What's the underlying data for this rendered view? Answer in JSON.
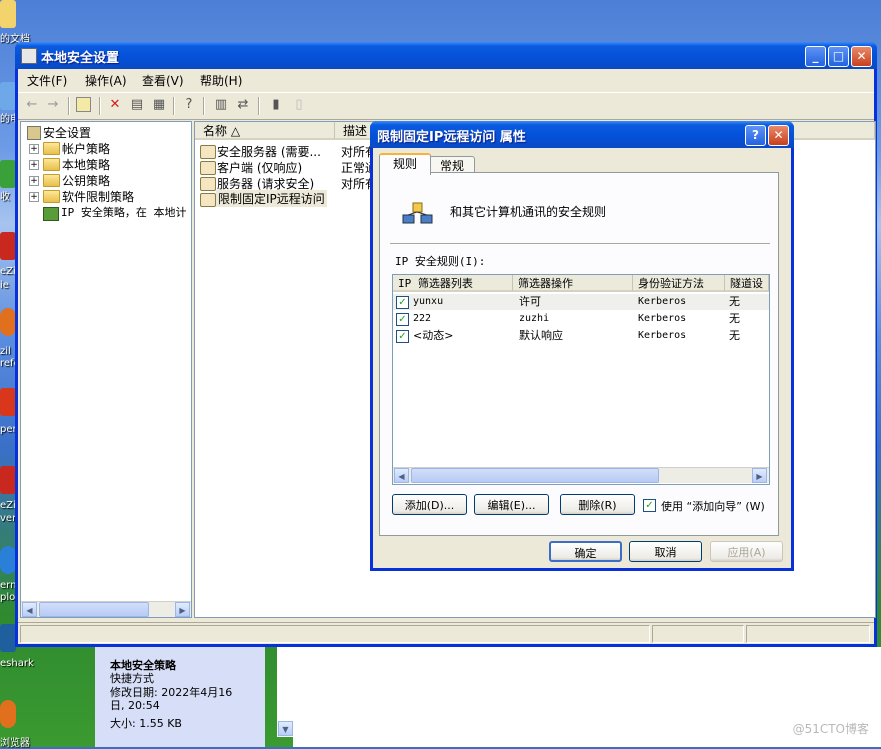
{
  "desktop": {
    "icons": [
      {
        "label": "的文档"
      },
      {
        "label": "的电"
      },
      {
        "label": "收"
      },
      {
        "label": "eZi"
      },
      {
        "label": "ie"
      },
      {
        "label": "zil"
      },
      {
        "label": "refo"
      },
      {
        "label": "per"
      },
      {
        "label": "eZi"
      },
      {
        "label": "ver"
      },
      {
        "label": "ern"
      },
      {
        "label": "plo"
      },
      {
        "label": "eshark"
      },
      {
        "label": "浏览器"
      }
    ],
    "watermark": "@51CTO博客"
  },
  "main_window": {
    "title": "本地安全设置",
    "menu": [
      "文件(F)",
      "操作(A)",
      "查看(V)",
      "帮助(H)"
    ],
    "tree": [
      {
        "label": "安全设置"
      },
      {
        "label": "帐户策略"
      },
      {
        "label": "本地策略"
      },
      {
        "label": "公钥策略"
      },
      {
        "label": "软件限制策略"
      },
      {
        "label": "IP 安全策略，在 本地计"
      }
    ],
    "columns": [
      "名称 △",
      "描述"
    ],
    "rows": [
      {
        "name": "安全服务器 (需要...",
        "desc": "对所有"
      },
      {
        "name": "客户端 (仅响应)",
        "desc": "正常通"
      },
      {
        "name": "服务器 (请求安全)",
        "desc": "对所有"
      },
      {
        "name": "限制固定IP远程访问",
        "desc": ""
      }
    ]
  },
  "dialog": {
    "title": "限制固定IP远程访问 属性",
    "tabs": [
      "规则",
      "常规"
    ],
    "description": "和其它计算机通讯的安全规则",
    "rules_label": "IP 安全规则(I):",
    "columns": [
      "IP 筛选器列表",
      "筛选器操作",
      "身份验证方法",
      "隧道设"
    ],
    "rules": [
      {
        "filter": "yunxu",
        "action": "许可",
        "auth": "Kerberos",
        "tunnel": "无",
        "checked": true
      },
      {
        "filter": "222",
        "action": "zuzhi",
        "auth": "Kerberos",
        "tunnel": "无",
        "checked": true
      },
      {
        "filter": "<动态>",
        "action": "默认响应",
        "auth": "Kerberos",
        "tunnel": "无",
        "checked": true
      }
    ],
    "buttons": {
      "add": "添加(D)...",
      "edit": "编辑(E)...",
      "remove": "删除(R)",
      "wizard": "使用 “添加向导” (W)",
      "ok": "确定",
      "cancel": "取消",
      "apply": "应用(A)"
    }
  },
  "details_pane": {
    "name": "本地安全策略",
    "type": "快捷方式",
    "modified": "修改日期: 2022年4月16日, 20:54",
    "size": "大小: 1.55 KB"
  }
}
